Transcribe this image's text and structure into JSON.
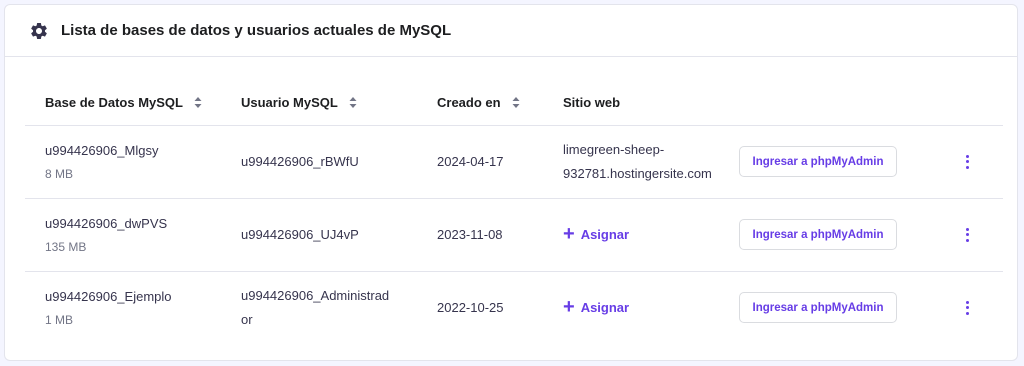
{
  "card": {
    "title": "Lista de bases de datos y usuarios actuales de MySQL",
    "icon": "gear-icon"
  },
  "table": {
    "columns": [
      {
        "label": "Base de Datos MySQL",
        "sortable": true
      },
      {
        "label": "Usuario MySQL",
        "sortable": true
      },
      {
        "label": "Creado en",
        "sortable": true
      },
      {
        "label": "Sitio web",
        "sortable": false
      }
    ],
    "rows": [
      {
        "database": "u994426906_Mlgsy",
        "size": "8 MB",
        "user": "u994426906_rBWfU",
        "created": "2024-04-17",
        "website": "limegreen-sheep-932781.hostingersite.com",
        "assign_label": "",
        "pma_label": "Ingresar a phpMyAdmin"
      },
      {
        "database": "u994426906_dwPVS",
        "size": "135 MB",
        "user": "u994426906_UJ4vP",
        "created": "2023-11-08",
        "website": "",
        "assign_label": "Asignar",
        "pma_label": "Ingresar a phpMyAdmin"
      },
      {
        "database": "u994426906_Ejemplo",
        "size": "1 MB",
        "user": "u994426906_Administrador",
        "created": "2022-10-25",
        "website": "",
        "assign_label": "Asignar",
        "pma_label": "Ingresar a phpMyAdmin"
      }
    ]
  },
  "colors": {
    "accent": "#673de6",
    "text": "#1d1e20",
    "muted": "#727586",
    "border": "#e3e4ec"
  }
}
